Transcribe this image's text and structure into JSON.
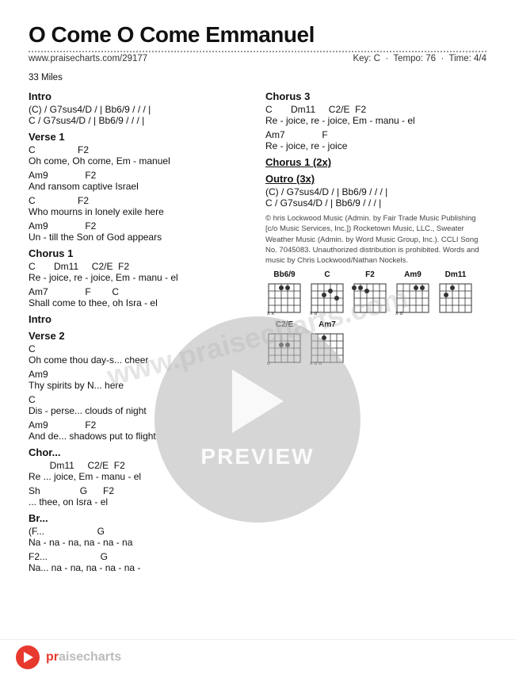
{
  "header": {
    "title": "O Come O Come Emmanuel",
    "url": "www.praisecharts.com/29177",
    "artist": "33 Miles",
    "key": "Key: C",
    "tempo": "Tempo: 76",
    "time": "Time: 4/4"
  },
  "sections": {
    "left": [
      {
        "id": "intro",
        "label": "Intro",
        "lines": [
          "(C) / G7sus4/D / | Bb6/9 / / / |",
          "C / G7sus4/D / | Bb6/9 / / / |"
        ]
      },
      {
        "id": "verse1",
        "label": "Verse 1",
        "groups": [
          {
            "chords": "C                F2",
            "lyrics": "Oh come, Oh come, Em - manuel"
          },
          {
            "chords": "Am9              F2",
            "lyrics": "And ransom captive Israel"
          },
          {
            "chords": "C                F2",
            "lyrics": "Who mourns in lonely exile here"
          },
          {
            "chords": "Am9              F2",
            "lyrics": "Un - till the Son of God appears"
          }
        ]
      },
      {
        "id": "chorus1",
        "label": "Chorus 1",
        "groups": [
          {
            "chords": "C       Dm11     C2/E  F2",
            "lyrics": "Re - joice, re - joice, Em - manu - el"
          },
          {
            "chords": "Am7              F        C",
            "lyrics": "Shall come to thee, oh Isra - el"
          }
        ]
      },
      {
        "id": "intro2",
        "label": "Intro",
        "lines": []
      },
      {
        "id": "verse2",
        "label": "Verse 2",
        "groups": [
          {
            "chords": "C",
            "lyrics": "Oh come thou day-s...             cheer"
          },
          {
            "chords": "Am9",
            "lyrics": "Thy spirits by N...              here"
          },
          {
            "chords": "C",
            "lyrics": "Dis - perse...   clouds of night"
          },
          {
            "chords": "Am9              F2",
            "lyrics": "And de...  shadows put to flight"
          }
        ]
      },
      {
        "id": "chorus2",
        "label": "Chorus",
        "partial": true,
        "groups": [
          {
            "chords": "        Dm11     C2/E  F2",
            "lyrics": "Re ...          joice, Em - manu - el"
          },
          {
            "chords": "Sh               G      F2",
            "lyrics": "...              thee, oh Isra - el"
          }
        ]
      },
      {
        "id": "bridge",
        "label": "Br...",
        "partial": true,
        "groups": [
          {
            "chords": "(F...                    G",
            "lyrics": "Na - na - na, na - na - na"
          },
          {
            "chords": "F2...                    G",
            "lyrics": "Na...  na - na, na - na - na -"
          }
        ]
      }
    ],
    "right": [
      {
        "id": "chorus3",
        "label": "Chorus 3",
        "groups": [
          {
            "chords": "C       Dm11     C2/E  F2",
            "lyrics": "Re - joice, re - joice, Em - manu - el"
          },
          {
            "chords": "Am7              F",
            "lyrics": "Re - joice, re - joice"
          }
        ]
      },
      {
        "id": "chorus1repeat",
        "label": "Chorus 1 (2x)",
        "groups": []
      },
      {
        "id": "outro",
        "label": "Outro (3x)",
        "lines": [
          "(C) / G7sus4/D / | Bb6/9 / / / |",
          "C / G7sus4/D / | Bb6/9 / / / |"
        ]
      },
      {
        "id": "copyright",
        "text": "© hris Lockwood Music (Admin. by Fair Trade Music Publishing [c/o Music Services, Inc.]) Rocketown Music, LLC., Sweater Weather Music (Admin. by Word Music Group, Inc.). CCLI Song No. 7045083. Unauthorized distribution is prohibited. Words and music by Chris Lockwood/Nathan Nockels."
      }
    ]
  },
  "chords": [
    "Bb6/9",
    "C",
    "F2",
    "Am9",
    "Dm11",
    "C2/E",
    "Am7"
  ],
  "preview": {
    "label": "PREVIEW"
  },
  "watermark": "www.praisecharts.com",
  "bottomBar": {
    "logo": "praisecharts"
  }
}
